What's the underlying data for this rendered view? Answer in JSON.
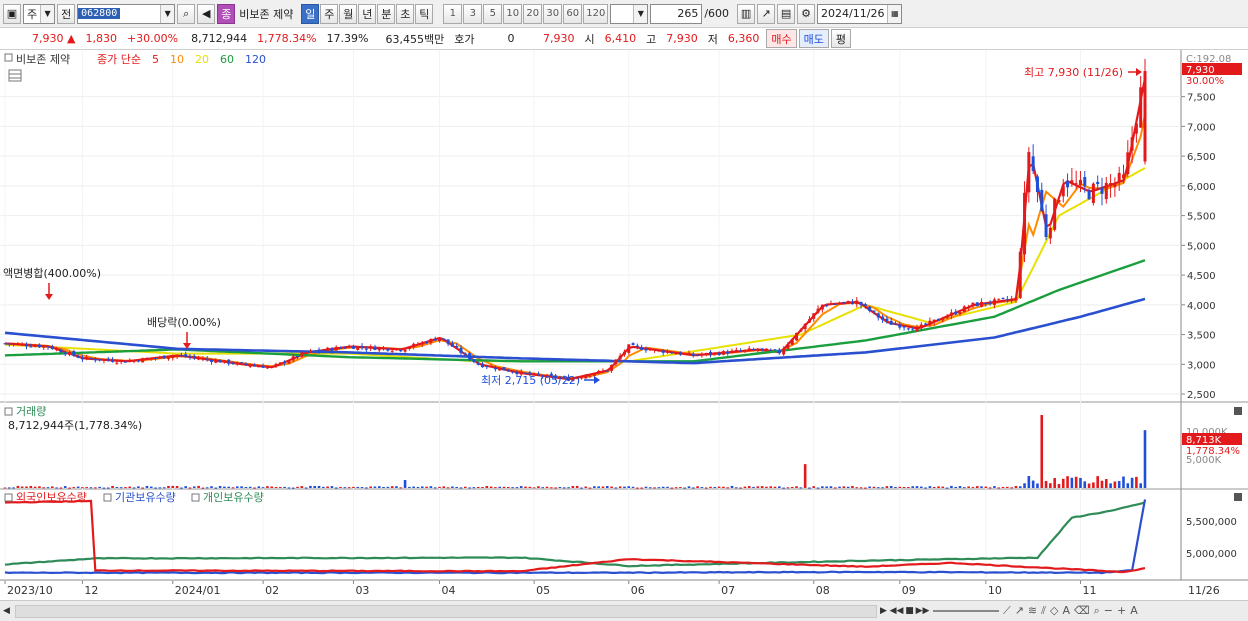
{
  "toolbar": {
    "market": "주",
    "prev": "전",
    "stock_code": "062800",
    "stock_name_badge": "종",
    "stock_name": "비보존 제약",
    "periods": [
      "일",
      "주",
      "월",
      "년",
      "분",
      "초",
      "틱"
    ],
    "active_period": "일",
    "period_numbers": [
      "1",
      "3",
      "5",
      "10",
      "20",
      "30",
      "60",
      "120"
    ],
    "count_value": "265",
    "count_total": "/600",
    "date": "2024/11/26"
  },
  "quote": {
    "price": "7,930",
    "change": "1,830",
    "change_pct": "+30.00%",
    "volume": "8,712,944",
    "volume_pct": "1,778.34%",
    "turnover": "17.39%",
    "amount": "63,455백만",
    "hoga_label": "호가",
    "hoga_value": "0",
    "hoga_price": "7,930",
    "open_label": "시",
    "open": "6,410",
    "high_label": "고",
    "high": "7,930",
    "low_label": "저",
    "low": "6,360",
    "buy_label": "매수",
    "sell_label": "매도",
    "eval_label": "평"
  },
  "price_panel": {
    "name": "비보존 제약",
    "ma_title": "종가 단순",
    "ma_periods": [
      "5",
      "10",
      "20",
      "60",
      "120"
    ],
    "ma_colors": [
      "#e31a1c",
      "#ff8c00",
      "#e8e000",
      "#1b9e3e",
      "#2a50d0"
    ],
    "top_label": "C:192.08",
    "last_price_tag": "7,930",
    "last_pct_tag": "30.00%",
    "y_ticks": [
      "7,500",
      "7,000",
      "6,500",
      "6,000",
      "5,500",
      "5,000",
      "4,500",
      "4,000",
      "3,500",
      "3,000",
      "2,500"
    ],
    "y_values": [
      7500,
      7000,
      6500,
      6000,
      5500,
      5000,
      4500,
      4000,
      3500,
      3000,
      2500
    ],
    "ylim": [
      2400,
      8200
    ],
    "annotations": {
      "high": "최고 7,930 (11/26)",
      "low": "최저 2,715 (05/22)",
      "split": "액면병합(400.00%)",
      "dividend": "배당락(0.00%)"
    }
  },
  "volume_panel": {
    "title": "거래량",
    "value": "8,712,944주(1,778.34%)",
    "y_tick": "10,000K",
    "y_tick2": "5,000K",
    "last_tag": "8,713K",
    "last_pct": "1,778.34%"
  },
  "holdings_panel": {
    "series": [
      "외국인보유수량",
      "기관보유수량",
      "개인보유수량"
    ],
    "colors": [
      "#e31a1c",
      "#2a50d0",
      "#2e8b57"
    ],
    "y_ticks": [
      "5,500,000",
      "5,000,000"
    ]
  },
  "x_axis": {
    "labels": [
      "2023/10",
      "12",
      "2024/01",
      "02",
      "03",
      "04",
      "05",
      "06",
      "07",
      "08",
      "09",
      "10",
      "11"
    ],
    "positions": [
      0,
      18,
      39,
      60,
      81,
      101,
      123,
      145,
      166,
      188,
      208,
      228,
      250
    ],
    "last_label": "11/26"
  },
  "chart_data": {
    "type": "line",
    "x_count": 265,
    "close_anchors": [
      [
        0,
        3350
      ],
      [
        10,
        3300
      ],
      [
        18,
        3100
      ],
      [
        28,
        3050
      ],
      [
        40,
        3150
      ],
      [
        55,
        3000
      ],
      [
        62,
        2950
      ],
      [
        70,
        3200
      ],
      [
        80,
        3300
      ],
      [
        92,
        3250
      ],
      [
        101,
        3450
      ],
      [
        110,
        3000
      ],
      [
        120,
        2850
      ],
      [
        131,
        2750
      ],
      [
        140,
        2900
      ],
      [
        145,
        3300
      ],
      [
        160,
        3150
      ],
      [
        175,
        3250
      ],
      [
        180,
        3200
      ],
      [
        185,
        3600
      ],
      [
        190,
        4000
      ],
      [
        198,
        4050
      ],
      [
        205,
        3700
      ],
      [
        212,
        3600
      ],
      [
        225,
        4000
      ],
      [
        235,
        4100
      ],
      [
        238,
        6600
      ],
      [
        242,
        5200
      ],
      [
        246,
        6100
      ],
      [
        252,
        5900
      ],
      [
        260,
        6100
      ],
      [
        265,
        7930
      ]
    ],
    "ma_anchors": {
      "ma20": [
        [
          0,
          3330
        ],
        [
          40,
          3180
        ],
        [
          80,
          3180
        ],
        [
          110,
          3050
        ],
        [
          145,
          3050
        ],
        [
          185,
          3500
        ],
        [
          200,
          4000
        ],
        [
          215,
          3700
        ],
        [
          235,
          4050
        ],
        [
          245,
          5500
        ],
        [
          265,
          6300
        ]
      ],
      "ma60": [
        [
          0,
          3150
        ],
        [
          40,
          3250
        ],
        [
          80,
          3120
        ],
        [
          120,
          3050
        ],
        [
          160,
          3050
        ],
        [
          200,
          3400
        ],
        [
          230,
          3800
        ],
        [
          245,
          4250
        ],
        [
          265,
          4750
        ]
      ],
      "ma120": [
        [
          0,
          3530
        ],
        [
          40,
          3260
        ],
        [
          80,
          3200
        ],
        [
          120,
          3100
        ],
        [
          160,
          3020
        ],
        [
          200,
          3200
        ],
        [
          230,
          3450
        ],
        [
          250,
          3800
        ],
        [
          265,
          4100
        ]
      ]
    },
    "volume_spikes": [
      [
        93,
        1200
      ],
      [
        186,
        3600
      ],
      [
        238,
        1800
      ],
      [
        241,
        11000
      ],
      [
        244,
        1500
      ],
      [
        265,
        8713
      ]
    ],
    "holdings": {
      "foreign": [
        [
          0,
          5700
        ],
        [
          20,
          5720
        ],
        [
          21,
          4800
        ],
        [
          120,
          4790
        ],
        [
          145,
          4950
        ],
        [
          200,
          4850
        ],
        [
          220,
          4900
        ],
        [
          260,
          4780
        ],
        [
          265,
          4830
        ]
      ],
      "institution": [
        [
          0,
          4770
        ],
        [
          140,
          4770
        ],
        [
          200,
          4780
        ],
        [
          255,
          4770
        ],
        [
          262,
          4800
        ],
        [
          265,
          5740
        ]
      ],
      "individual": [
        [
          0,
          4880
        ],
        [
          21,
          4960
        ],
        [
          120,
          4970
        ],
        [
          145,
          4860
        ],
        [
          200,
          4930
        ],
        [
          240,
          4970
        ],
        [
          248,
          5500
        ],
        [
          258,
          5600
        ],
        [
          265,
          5700
        ]
      ]
    }
  }
}
